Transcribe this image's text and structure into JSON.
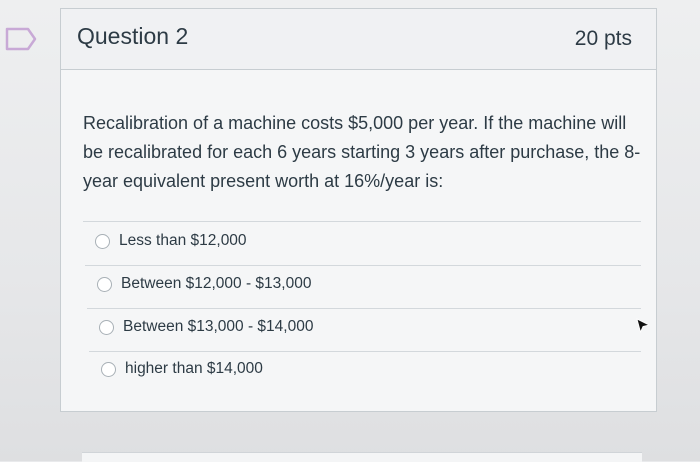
{
  "question": {
    "title": "Question 2",
    "points": "20 pts",
    "text": "Recalibration of a machine costs $5,000 per year. If the machine will be recalibrated for each 6 years starting 3 years after purchase, the 8-year equivalent present worth at 16%/year is:"
  },
  "answers": [
    {
      "label": "Less than $12,000",
      "selected": false
    },
    {
      "label": "Between $12,000 - $13,000",
      "selected": false
    },
    {
      "label": "Between $13,000 - $14,000",
      "selected": false
    },
    {
      "label": "higher than $14,000",
      "selected": false
    }
  ],
  "icons": {
    "flag": "flag-icon",
    "cursor": "mouse-pointer-icon"
  },
  "colors": {
    "text": "#2d3b45",
    "flag": "#c8a9d6",
    "border": "#c7cdd1"
  }
}
